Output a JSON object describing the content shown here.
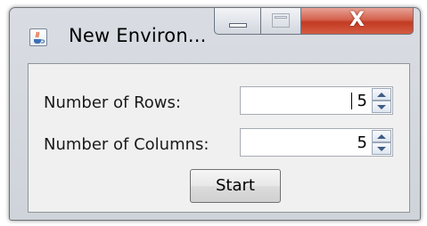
{
  "window": {
    "title": "New Environ...",
    "icon": "java-cup-icon",
    "caption_buttons": {
      "minimize_icon": "minimize-icon",
      "maximize_icon": "maximize-icon",
      "close_icon": "close-icon",
      "close_glyph": "X",
      "close_color": "#c8412a"
    }
  },
  "form": {
    "rows": {
      "label": "Number of Rows:",
      "value": "5"
    },
    "columns": {
      "label": "Number of Columns:",
      "value": "5"
    },
    "start_label": "Start"
  }
}
